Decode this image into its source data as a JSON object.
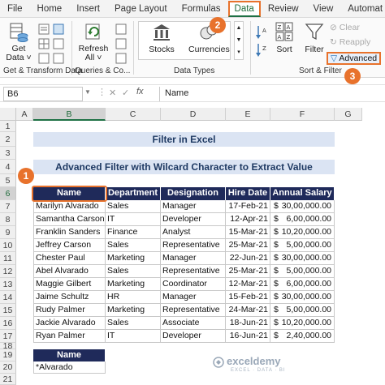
{
  "ribbon": {
    "tabs": [
      "File",
      "Home",
      "Insert",
      "Page Layout",
      "Formulas",
      "Data",
      "Review",
      "View",
      "Automat"
    ],
    "active_tab": "Data",
    "get_data": {
      "line1": "Get",
      "line2": "Data ˅"
    },
    "refresh_all": {
      "line1": "Refresh",
      "line2": "All ˅"
    },
    "stocks": "Stocks",
    "currencies": "Currencies",
    "sort": "Sort",
    "filter": "Filter",
    "clear": "Clear",
    "reapply": "Reapply",
    "advanced": "Advanced",
    "groups": {
      "get_transform": "Get & Transform Data",
      "queries": "Queries & Co...",
      "data_types": "Data Types",
      "sort_filter": "Sort & Filter"
    }
  },
  "callouts": {
    "one": "1",
    "two": "2",
    "three": "3"
  },
  "formula_bar": {
    "name_box": "B6",
    "fx": "fx",
    "content": "Name"
  },
  "columns": [
    "A",
    "B",
    "C",
    "D",
    "E",
    "F",
    "G"
  ],
  "rows": [
    "1",
    "2",
    "3",
    "4",
    "5",
    "6",
    "7",
    "8",
    "9",
    "10",
    "11",
    "12",
    "13",
    "14",
    "15",
    "16",
    "17",
    "18",
    "19",
    "20",
    "21"
  ],
  "sheet": {
    "title": "Filter in Excel",
    "subtitle": "Advanced Filter with Wilcard Character to Extract Value",
    "headers": [
      "Name",
      "Department",
      "Designation",
      "Hire Date",
      "Annual Salary"
    ],
    "records": [
      [
        "Marilyn Alvarado",
        "Sales",
        "Manager",
        "17-Feb-21",
        "$",
        "30,00,000.00"
      ],
      [
        "Samantha Carson",
        "IT",
        "Developer",
        "12-Apr-21",
        "$",
        "6,00,000.00"
      ],
      [
        "Franklin Sanders",
        "Finance",
        "Analyst",
        "15-Mar-21",
        "$",
        "10,20,000.00"
      ],
      [
        "Jeffrey Carson",
        "Sales",
        "Representative",
        "25-Mar-21",
        "$",
        "5,00,000.00"
      ],
      [
        "Chester Paul",
        "Marketing",
        "Manager",
        "22-Jun-21",
        "$",
        "30,00,000.00"
      ],
      [
        "Abel Alvarado",
        "Sales",
        "Representative",
        "25-Mar-21",
        "$",
        "5,00,000.00"
      ],
      [
        "Maggie Gilbert",
        "Marketing",
        "Coordinator",
        "12-Mar-21",
        "$",
        "6,00,000.00"
      ],
      [
        "Jaime Schultz",
        "HR",
        "Manager",
        "15-Feb-21",
        "$",
        "30,00,000.00"
      ],
      [
        "Rudy Palmer",
        "Marketing",
        "Representative",
        "24-Mar-21",
        "$",
        "5,00,000.00"
      ],
      [
        "Jackie Alvarado",
        "Sales",
        "Associate",
        "18-Jun-21",
        "$",
        "10,20,000.00"
      ],
      [
        "Ryan Palmer",
        "IT",
        "Developer",
        "16-Jun-21",
        "$",
        "2,40,000.00"
      ]
    ],
    "criteria_header": "Name",
    "criteria_value": "*Alvarado"
  },
  "watermark": {
    "brand": "exceldemy",
    "tagline": "EXCEL · DATA · BI"
  },
  "colors": {
    "accent": "#e8722c",
    "header_fill": "#1f2a5a",
    "banner_fill": "#dbe4f3",
    "excel_green": "#1e7145"
  }
}
